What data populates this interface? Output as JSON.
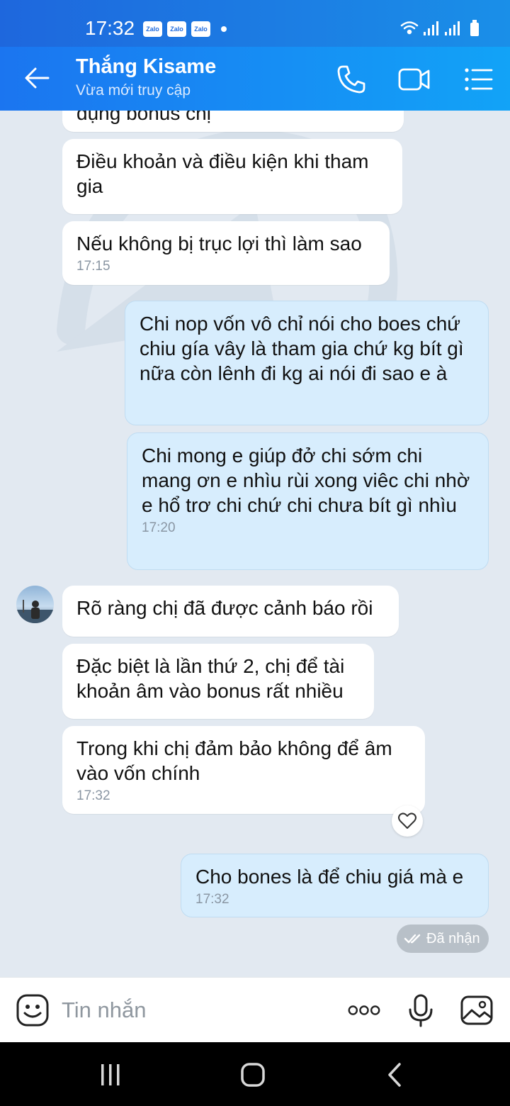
{
  "status_bar": {
    "time": "17:32",
    "notif_badges": [
      "Zalo",
      "Zalo",
      "Zalo"
    ]
  },
  "header": {
    "contact_name": "Thắng Kisame",
    "status": "Vừa mới truy cập"
  },
  "messages": [
    {
      "side": "in",
      "text": "dụng bonus chị",
      "time": ""
    },
    {
      "side": "in",
      "text": "Điều khoản và điều kiện khi tham gia",
      "time": ""
    },
    {
      "side": "in",
      "text": "Nếu không bị trục lợi thì làm sao",
      "time": "17:15"
    },
    {
      "side": "out",
      "text": "Chi nop vốn vô chỉ nói cho boes chứ  chiu gía vây là tham gia chứ kg bít gì nữa  còn lênh đi kg ai nói đi sao  e à",
      "time": ""
    },
    {
      "side": "out",
      "text": "Chi mong e giúp đở chi sớm chi mang ơn e nhìu rùi xong viêc chi nhờ e hổ trơ chi  chứ chi chưa bít gì nhìu",
      "time": "17:20"
    },
    {
      "side": "in",
      "text": "Rõ ràng chị đã được cảnh báo rồi",
      "time": ""
    },
    {
      "side": "in",
      "text": "Đặc biệt là lần thứ 2, chị để tài khoản âm vào bonus rất nhiều",
      "time": ""
    },
    {
      "side": "in",
      "text": "Trong khi chị đảm bảo không để âm vào vốn chính",
      "time": "17:32"
    },
    {
      "side": "out",
      "text": "Cho bones là để chiu giá mà e",
      "time": "17:32"
    }
  ],
  "delivery_status": "Đã nhận",
  "input": {
    "placeholder": "Tin nhắn"
  },
  "colors": {
    "header_start": "#1b75f0",
    "header_end": "#12a3f7",
    "chat_bg": "#e2e9f1",
    "outgoing_bubble": "#d7edfd",
    "incoming_bubble": "#ffffff"
  }
}
